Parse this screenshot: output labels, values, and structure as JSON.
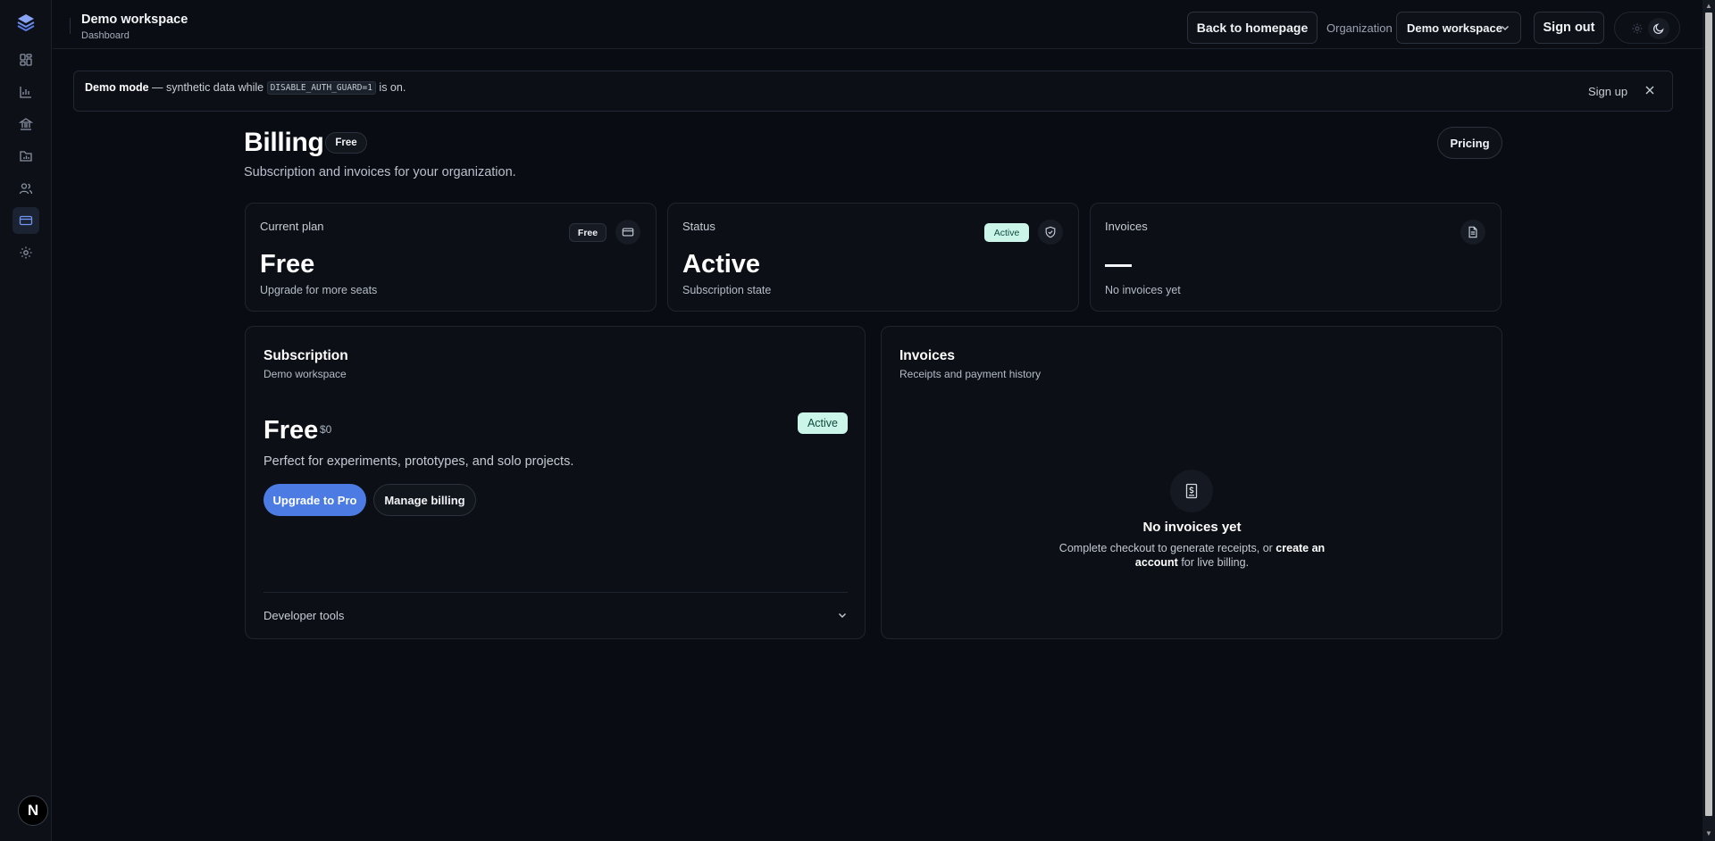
{
  "header": {
    "workspace_title": "Demo workspace",
    "subtitle": "Dashboard",
    "back_button": "Back to homepage",
    "org_label": "Organization",
    "org_selected": "Demo workspace",
    "sign_out": "Sign out"
  },
  "sidebar": {
    "items": [
      {
        "name": "dashboard",
        "icon": "dashboard-grid-icon"
      },
      {
        "name": "analytics",
        "icon": "bar-chart-icon"
      },
      {
        "name": "bank",
        "icon": "bank-icon"
      },
      {
        "name": "reports",
        "icon": "folder-chart-icon"
      },
      {
        "name": "users",
        "icon": "users-icon"
      },
      {
        "name": "billing",
        "icon": "credit-card-icon",
        "active": true
      },
      {
        "name": "settings",
        "icon": "gear-icon"
      }
    ],
    "avatar_letter": "N"
  },
  "banner": {
    "mode_label": "Demo mode",
    "text_before": " — synthetic data while ",
    "code": "DISABLE_AUTH_GUARD=1",
    "text_after": " is on.",
    "signup": "Sign up"
  },
  "page": {
    "title": "Billing",
    "title_badge": "Free",
    "subtitle": "Subscription and invoices for your organization.",
    "pricing_button": "Pricing"
  },
  "stats": {
    "plan": {
      "label": "Current plan",
      "badge": "Free",
      "value": "Free",
      "caption": "Upgrade for more seats"
    },
    "status": {
      "label": "Status",
      "badge": "Active",
      "value": "Active",
      "caption": "Subscription state"
    },
    "invoices": {
      "label": "Invoices",
      "value": "—",
      "caption": "No invoices yet"
    }
  },
  "subscription": {
    "title": "Subscription",
    "subtitle": "Demo workspace",
    "plan_name": "Free",
    "price": "$0",
    "status_badge": "Active",
    "description": "Perfect for experiments, prototypes, and solo projects.",
    "upgrade_button": "Upgrade to Pro",
    "manage_button": "Manage billing",
    "dev_tools": "Developer tools"
  },
  "invoices_panel": {
    "title": "Invoices",
    "subtitle": "Receipts and payment history",
    "empty_title": "No invoices yet",
    "empty_text_1": "Complete checkout to generate receipts, or ",
    "empty_link": "create an account",
    "empty_text_2": " for live billing."
  },
  "colors": {
    "background": "#090c12",
    "accent": "#4c7ce3",
    "active_badge": "#ccf5ea"
  }
}
